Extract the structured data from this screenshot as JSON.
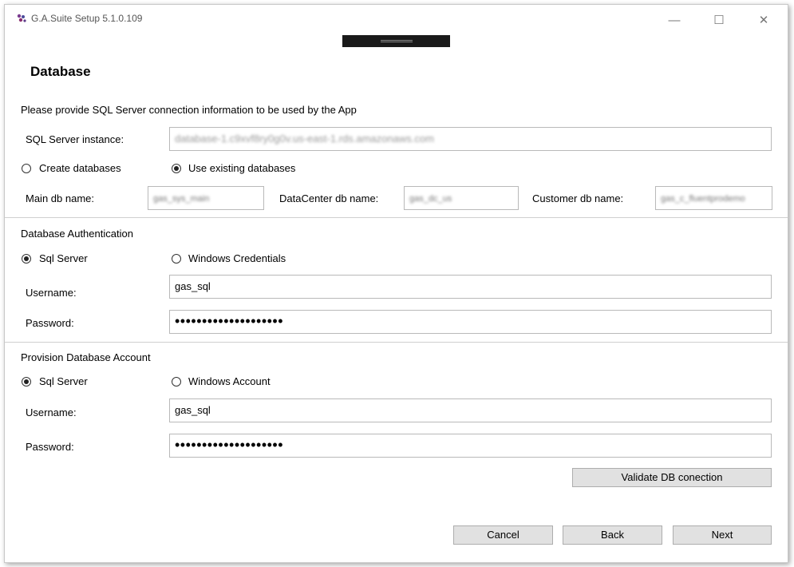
{
  "window": {
    "title": "G.A.Suite Setup 5.1.0.109",
    "controls": {
      "minimize": "—",
      "maximize": "☐",
      "close": "✕"
    }
  },
  "page": {
    "heading": "Database",
    "instruction": "Please provide SQL Server connection information to be used by the App"
  },
  "sql_server": {
    "instance_label": "SQL Server instance:",
    "instance_value": "database-1.c9xvf8ry0g0v.us-east-1.rds.amazonaws.com",
    "create_label": "Create databases",
    "existing_label": "Use existing databases",
    "selected": "existing",
    "main_db_label": "Main db name:",
    "main_db_value": "gas_sys_main",
    "datacenter_db_label": "DataCenter db name:",
    "datacenter_db_value": "gas_dc_us",
    "customer_db_label": "Customer db name:",
    "customer_db_value": "gas_c_fluentprodemo"
  },
  "db_auth": {
    "section_label": "Database Authentication",
    "sql_label": "Sql Server",
    "windows_label": "Windows Credentials",
    "selected": "sql",
    "username_label": "Username:",
    "username_value": "gas_sql",
    "password_label": "Password:",
    "password_value": "••••••••••••••••••••"
  },
  "provision": {
    "section_label": "Provision Database Account",
    "sql_label": "Sql Server",
    "windows_label": "Windows Account",
    "selected": "sql",
    "username_label": "Username:",
    "username_value": "gas_sql",
    "password_label": "Password:",
    "password_value": "••••••••••••••••••••"
  },
  "buttons": {
    "validate": "Validate DB conection",
    "cancel": "Cancel",
    "back": "Back",
    "next": "Next"
  }
}
